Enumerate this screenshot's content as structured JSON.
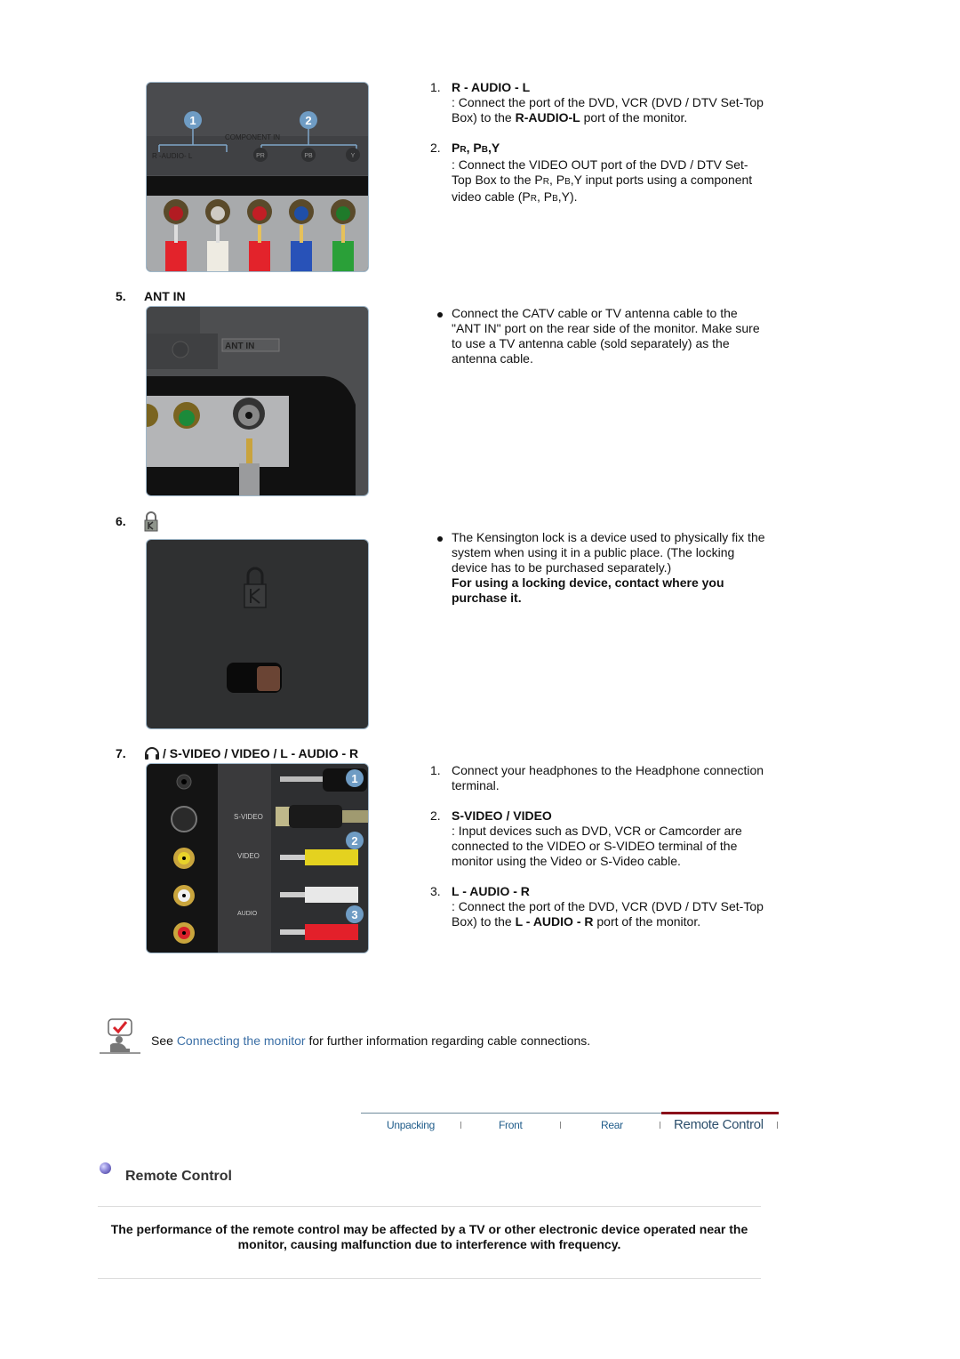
{
  "component": {
    "items": [
      {
        "num": "1.",
        "title": "R - AUDIO - L",
        "text_pre": ": Connect the port of the DVD, VCR (DVD / DTV Set-Top Box) to the ",
        "text_bold": "R-AUDIO-L",
        "text_post": " port of the monitor."
      },
      {
        "num": "2.",
        "title_parts": [
          "P",
          "R",
          ", P",
          "B",
          ",Y"
        ],
        "text_a": ": Connect the VIDEO OUT port of the DVD / DTV Set-Top Box to the P",
        "text_sub1": "R",
        "text_b": ", P",
        "text_sub2": "B",
        "text_c": ",Y input ports using a component video cable (P",
        "text_sub3": "R",
        "text_d": ", P",
        "text_sub4": "B",
        "text_e": ",Y)."
      }
    ],
    "photo_labels": {
      "badge1": "1",
      "badge2": "2",
      "panel": "COMPONENT IN",
      "audio": "R -AUDIO- L",
      "pr": "PR",
      "pb": "PB",
      "y": "Y"
    }
  },
  "ant_in": {
    "num": "5.",
    "title": "ANT IN",
    "bullet": "Connect the CATV cable or TV antenna cable to the \"ANT IN\" port on the rear side of the monitor. Make sure to use a TV antenna cable (sold separately) as the antenna cable.",
    "photo_label": "ANT IN"
  },
  "kensington": {
    "num": "6.",
    "icon": "kensington-lock-icon",
    "bullet": "The Kensington lock is a device used to physically fix the system when using it in a public place. (The locking device has to be purchased separately.)",
    "bullet_bold": "For using a locking device, contact where you purchase it."
  },
  "av": {
    "num": "7.",
    "title_sep": " / ",
    "title": "S-VIDEO / VIDEO / L - AUDIO - R",
    "photo_labels": {
      "svideo": "S-VIDEO",
      "video": "VIDEO",
      "audio": "AUDIO",
      "b1": "1",
      "b2": "2",
      "b3": "3"
    },
    "items": [
      {
        "num": "1.",
        "text": "Connect your headphones to the Headphone connection terminal."
      },
      {
        "num": "2.",
        "title": "S-VIDEO / VIDEO",
        "text": ": Input devices such as DVD, VCR or Camcorder are connected to the VIDEO or S-VIDEO terminal of the monitor using the Video or S-Video cable."
      },
      {
        "num": "3.",
        "title": "L - AUDIO - R",
        "text_pre": ": Connect the port of the DVD, VCR (DVD / DTV Set-Top Box) to the ",
        "text_bold": "L - AUDIO - R",
        "text_post": " port of the monitor."
      }
    ]
  },
  "note": {
    "pre": "See ",
    "link": "Connecting the monitor",
    "post": " for further information regarding cable connections."
  },
  "tabs": [
    {
      "label": "Unpacking",
      "active": false
    },
    {
      "label": "Front",
      "active": false
    },
    {
      "label": "Rear",
      "active": false
    },
    {
      "label": "Remote Control",
      "active": true
    }
  ],
  "remote": {
    "heading": "Remote Control",
    "warning": "The performance of the remote control may be affected by a TV or other electronic device operated near the monitor, causing malfunction due to interference with frequency."
  },
  "colors": {
    "link": "#3b6fa6",
    "tab_active_bar": "#8b0d1a",
    "tab_text": "#1f5c8a",
    "badge": "#6f9cc4"
  }
}
